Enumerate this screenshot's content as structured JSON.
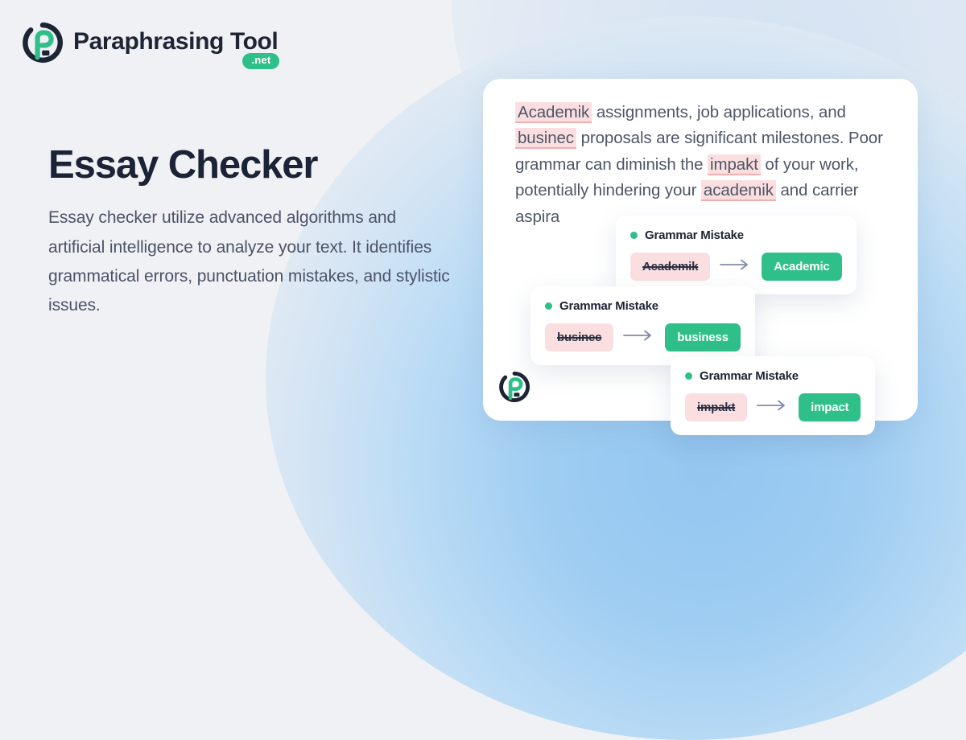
{
  "brand": {
    "name": "Paraphrasing Tool",
    "badge": ".net",
    "logo_icon": "paraphrasing-tool-logo-icon",
    "accent_green": "#2fc08a",
    "dark_navy": "#1d2434"
  },
  "hero": {
    "title": "Essay Checker",
    "description": "Essay checker utilize advanced algorithms and artificial intelligence to analyze your text. It identifies grammatical errors, punctuation mistakes, and stylistic issues."
  },
  "editor": {
    "logo_icon": "paraphrasing-tool-logo-icon",
    "segments": [
      {
        "text": "Academik",
        "error": true
      },
      {
        "text": " assignments, job applications, and ",
        "error": false
      },
      {
        "text": "businec",
        "error": true
      },
      {
        "text": " proposals are significant milestones. Poor grammar can diminish the ",
        "error": false
      },
      {
        "text": "impakt",
        "error": true
      },
      {
        "text": " of your work, potentially hindering your ",
        "error": false
      },
      {
        "text": "academik",
        "error": true
      },
      {
        "text": " and carrier aspira",
        "error": false
      }
    ],
    "highlight_bg": "#fbdfe0",
    "highlight_underline": "#f3aeb0"
  },
  "suggestions": [
    {
      "label": "Grammar Mistake",
      "wrong": "Academik",
      "correct": "Academic",
      "arrow_icon": "arrow-right-icon",
      "status_icon": "status-dot-icon"
    },
    {
      "label": "Grammar Mistake",
      "wrong": "businec",
      "correct": "business",
      "arrow_icon": "arrow-right-icon",
      "status_icon": "status-dot-icon"
    },
    {
      "label": "Grammar Mistake",
      "wrong": "impakt",
      "correct": "impact",
      "arrow_icon": "arrow-right-icon",
      "status_icon": "status-dot-icon"
    }
  ]
}
